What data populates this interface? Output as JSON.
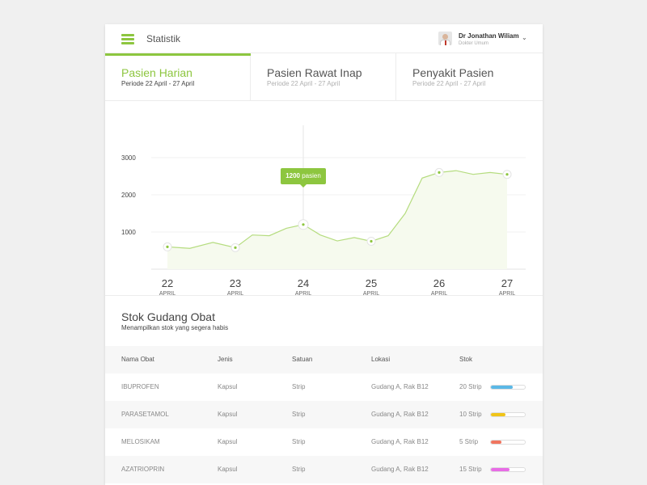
{
  "header": {
    "title": "Statistik",
    "user_name": "Dr Jonathan Wiliam",
    "user_role": "Dokter Umum",
    "caret": "⌄"
  },
  "tabs": [
    {
      "label": "Pasien Harian",
      "period": "Periode 22 April - 27 April",
      "active": true
    },
    {
      "label": "Pasien Rawat Inap",
      "period": "Periode 22 April - 27 April",
      "active": false
    },
    {
      "label": "Penyakit Pasien",
      "period": "Periode 22 April - 27 April",
      "active": false
    }
  ],
  "chart_data": {
    "type": "line",
    "y_ticks": [
      "3000",
      "2000",
      "1000"
    ],
    "ylim": [
      0,
      3000
    ],
    "x_days": [
      "22",
      "23",
      "24",
      "25",
      "26",
      "27"
    ],
    "x_month": "APRIL",
    "series": [
      {
        "x": [
          22,
          22.33,
          22.67,
          23,
          23.25,
          23.5,
          23.75,
          24,
          24.25,
          24.5,
          24.75,
          25,
          25.25,
          25.5,
          25.75,
          26,
          26.25,
          26.5,
          26.75,
          27
        ],
        "values": [
          600,
          560,
          720,
          580,
          920,
          900,
          1100,
          1200,
          920,
          760,
          850,
          750,
          900,
          1500,
          2450,
          2600,
          2650,
          2550,
          2600,
          2550
        ]
      }
    ],
    "highlight": {
      "x": 24,
      "value": "1200",
      "unit": "pasien"
    },
    "color": "#8dc63f"
  },
  "stock": {
    "title": "Stok Gudang Obat",
    "subtitle": "Menampilkan stok yang segera habis",
    "columns": [
      "Nama Obat",
      "Jenis",
      "Satuan",
      "Lokasi",
      "Stok"
    ],
    "rows": [
      {
        "name": "IBUPROFEN",
        "type": "Kapsul",
        "unit": "Strip",
        "location": "Gudang A, Rak B12",
        "stock": "20 Strip",
        "level": 0.65,
        "color": "#5bb8e6"
      },
      {
        "name": "PARASETAMOL",
        "type": "Kapsul",
        "unit": "Strip",
        "location": "Gudang A, Rak B12",
        "stock": "10 Strip",
        "level": 0.42,
        "color": "#f0c419"
      },
      {
        "name": "MELOSIKAM",
        "type": "Kapsul",
        "unit": "Strip",
        "location": "Gudang A, Rak B12",
        "stock": "5 Strip",
        "level": 0.3,
        "color": "#f0755f"
      },
      {
        "name": "AZATRIOPRIN",
        "type": "Kapsul",
        "unit": "Strip",
        "location": "Gudang A, Rak B12",
        "stock": "15 Strip",
        "level": 0.55,
        "color": "#e86ce6"
      }
    ]
  }
}
